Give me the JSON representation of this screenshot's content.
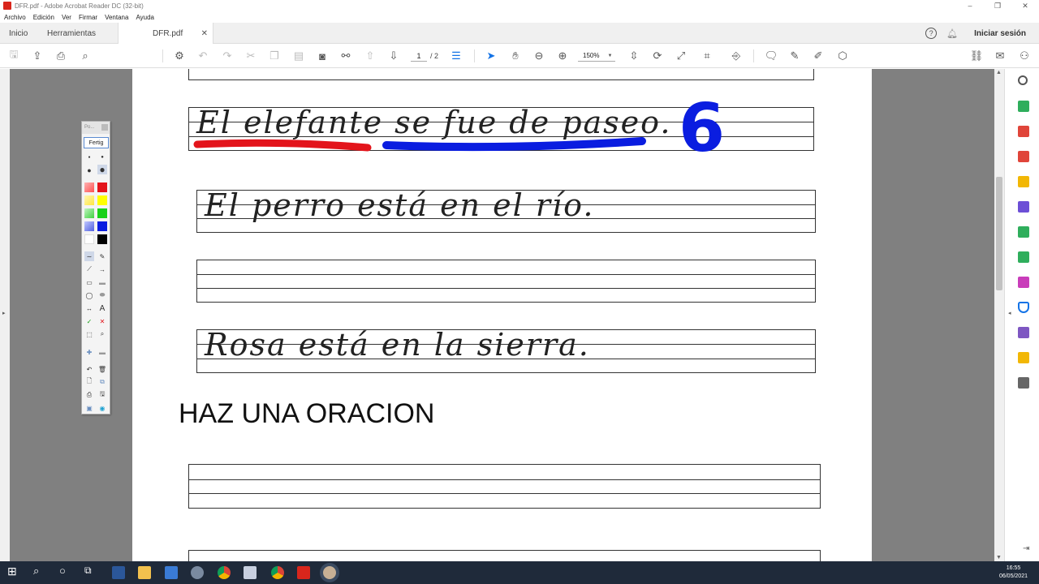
{
  "window": {
    "title": "DFR.pdf - Adobe Acrobat Reader DC (32-bit)",
    "controls": [
      "–",
      "❐",
      "✕"
    ]
  },
  "menu": [
    "Archivo",
    "Edición",
    "Ver",
    "Firmar",
    "Ventana",
    "Ayuda"
  ],
  "tabs": {
    "home": "Inicio",
    "tools": "Herramientas",
    "document": "DFR.pdf",
    "close": "✕",
    "help": "?",
    "signin": "Iniciar sesión"
  },
  "toolbar": {
    "page_current": "1",
    "page_total": "/ 2",
    "zoom": "150%",
    "zoom_caret": "▼"
  },
  "document": {
    "sentence1": "El elefante se fue de paseo.",
    "marker_number": "6",
    "sentence2": "El perro está en el río.",
    "sentence3": "Rosa está en la sierra.",
    "heading": "HAZ UNA ORACION"
  },
  "palette": {
    "header": "Po...",
    "done_button": "Fertig"
  },
  "colors": {
    "red_underline": "#e3141b",
    "blue_underline": "#0a1de0",
    "blue_marker": "#0a1de0",
    "taskbar": "#1f2a3a",
    "accent": "#1473e6"
  },
  "taskbar": {
    "time": "16:55",
    "date": "06/05/2021"
  }
}
